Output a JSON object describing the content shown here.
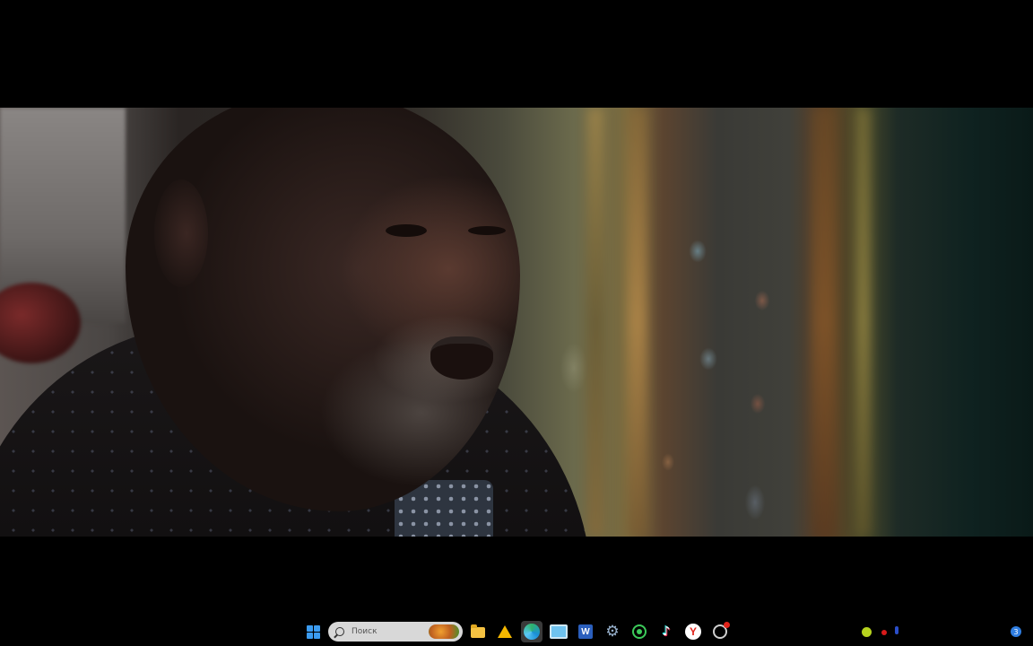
{
  "taskbar": {
    "search": {
      "placeholder": "Поиск"
    },
    "apps": [
      {
        "icon": "windows-start-icon"
      },
      {
        "icon": "search-icon"
      },
      {
        "icon": "file-explorer-icon"
      },
      {
        "icon": "triangle-app-icon"
      },
      {
        "icon": "edge-browser-icon",
        "active": true
      },
      {
        "icon": "remote-desktop-icon"
      },
      {
        "icon": "word-icon",
        "label": "W"
      },
      {
        "icon": "settings-gear-icon"
      },
      {
        "icon": "whatsapp-icon"
      },
      {
        "icon": "tiktok-icon",
        "label": "♪"
      },
      {
        "icon": "yandex-icon",
        "label": "Y"
      },
      {
        "icon": "notification-app-icon"
      }
    ],
    "tray": {
      "notification_count": "3"
    }
  },
  "colors": {
    "taskbar_bg": "#000000",
    "windows_blue": "#3b9bf0",
    "active_bg": "#3a3a3a"
  }
}
